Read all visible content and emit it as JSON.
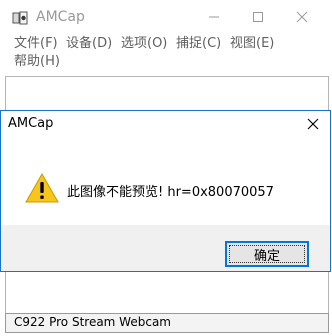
{
  "main_window": {
    "title": "AMCap",
    "menu": [
      {
        "label": "文件(F)"
      },
      {
        "label": "设备(D)"
      },
      {
        "label": "选项(O)"
      },
      {
        "label": "捕捉(C)"
      },
      {
        "label": "视图(E)"
      },
      {
        "label": "帮助(H)"
      }
    ],
    "status_text": "C922 Pro Stream Webcam"
  },
  "dialog": {
    "title": "AMCap",
    "message": "此图像不能预览! hr=0x80070057",
    "ok_label": "确定",
    "icon": "warning-icon"
  },
  "colors": {
    "accent": "#0078d7",
    "warning": "#f7c51b",
    "dialog_border": "#1a73c8"
  }
}
